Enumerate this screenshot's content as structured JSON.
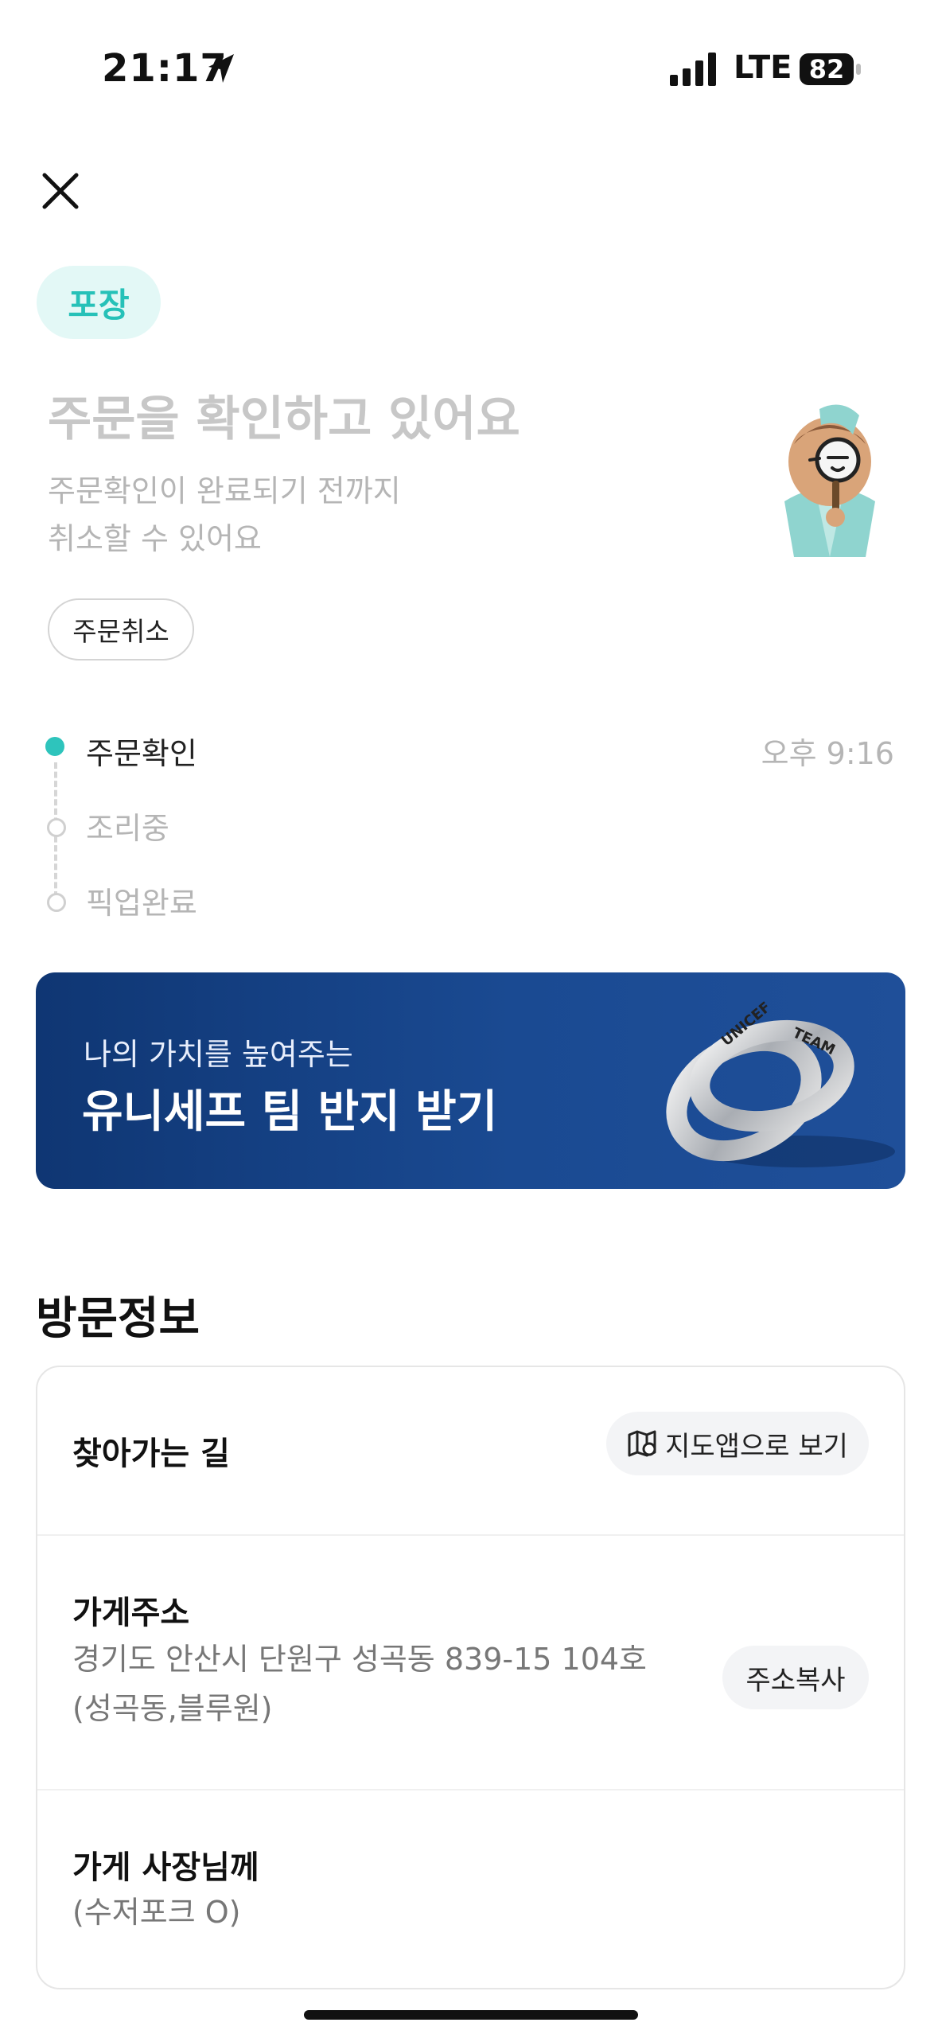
{
  "status_bar": {
    "time": "21:17",
    "network": "LTE",
    "battery": "82"
  },
  "order": {
    "tag": "포장",
    "title": "주문을 확인하고 있어요",
    "subtitle_line1": "주문확인이 완료되기 전까지",
    "subtitle_line2": "취소할 수 있어요",
    "cancel_label": "주문취소"
  },
  "steps": [
    {
      "label": "주문확인",
      "time": "오후 9:16",
      "active": true
    },
    {
      "label": "조리중"
    },
    {
      "label": "픽업완료"
    }
  ],
  "banner": {
    "subtitle": "나의 가치를 높여주는",
    "title": "유니세프 팀 반지 받기",
    "ring_text_1": "UNICEF",
    "ring_text_2": "TEAM"
  },
  "visit_info": {
    "section_title": "방문정보",
    "directions_label": "찾아가는 길",
    "map_button_label": "지도앱으로 보기",
    "address_label": "가게주소",
    "address_line1": "경기도 안산시 단원구 성곡동 839-15 104호",
    "address_line2": "(성곡동,블루원)",
    "copy_address_label": "주소복사",
    "owner_label": "가게 사장님께",
    "owner_note": "(수저포크 O)"
  },
  "colors": {
    "accent": "#2ec4bc",
    "banner_bg": "#1a4a92"
  }
}
